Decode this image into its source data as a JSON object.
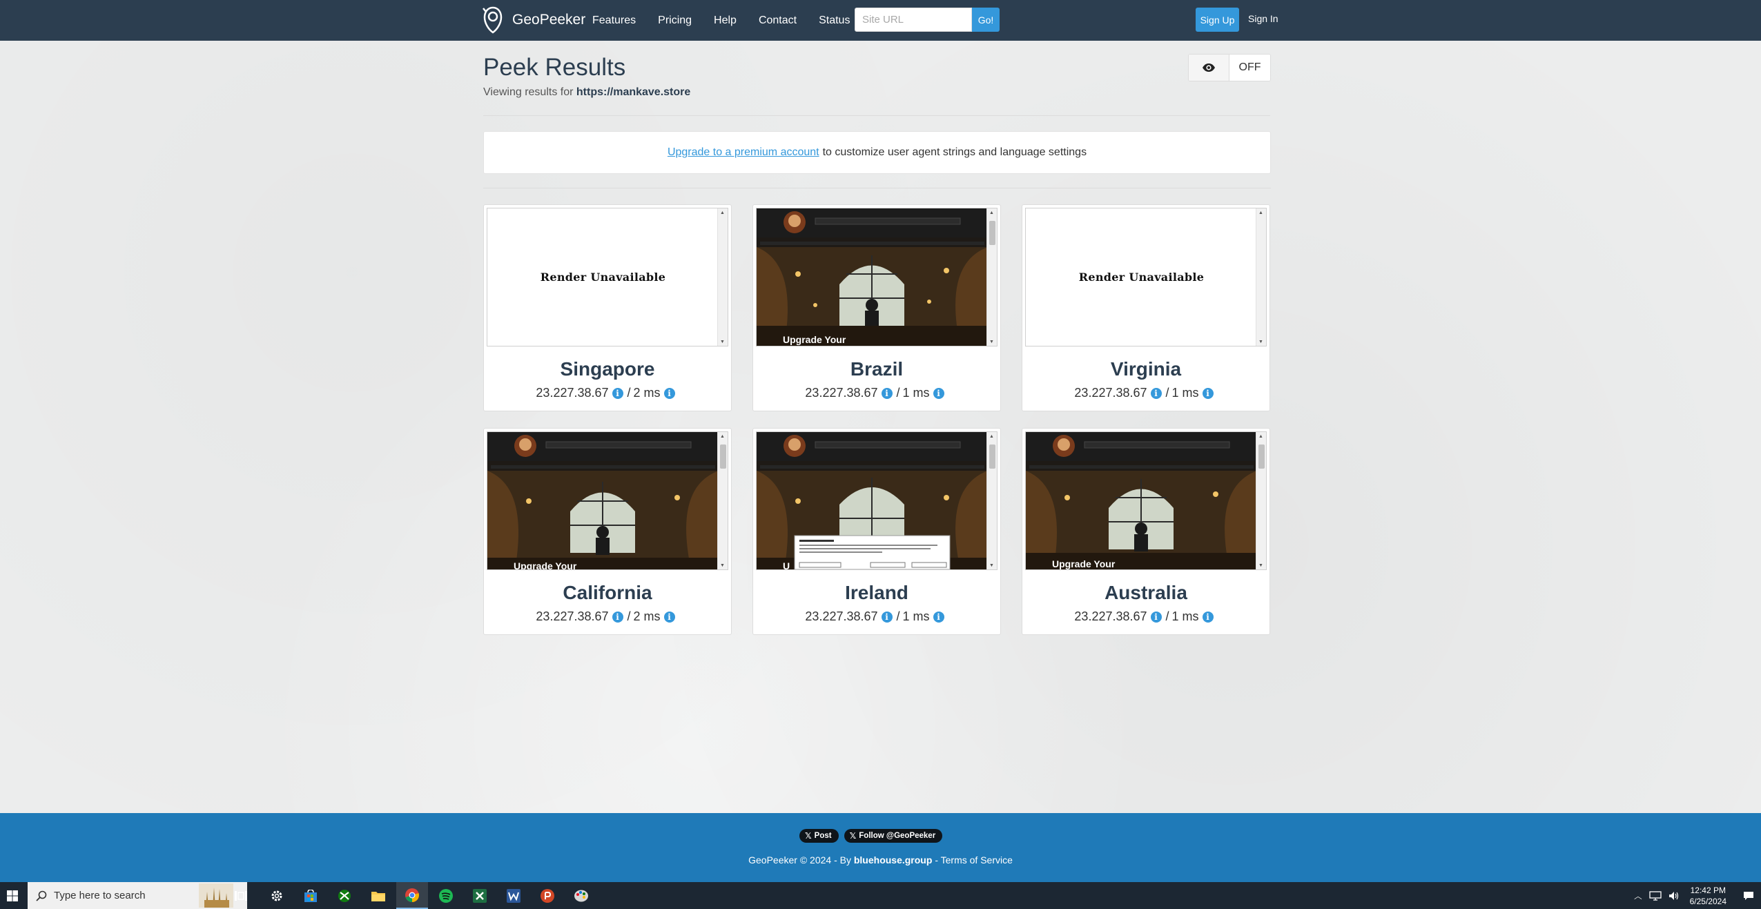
{
  "navbar": {
    "brand": "GeoPeeker",
    "links": [
      "Features",
      "Pricing",
      "Help",
      "Contact",
      "Status"
    ],
    "url_placeholder": "Site URL",
    "go_label": "Go!",
    "signup_label": "Sign Up",
    "signin_label": "Sign In"
  },
  "header": {
    "title": "Peek Results",
    "subtitle_prefix": "Viewing results for",
    "url": "https://mankave.store",
    "toggle_state": "OFF"
  },
  "upgrade": {
    "link_text": "Upgrade to a premium account",
    "rest_text": "to customize user agent strings and language settings"
  },
  "results": [
    {
      "location": "Singapore",
      "ip": "23.227.38.67",
      "latency": "2 ms",
      "render": "unavailable",
      "unavailable_text": "Render Unavailable"
    },
    {
      "location": "Brazil",
      "ip": "23.227.38.67",
      "latency": "1 ms",
      "render": "screenshot",
      "banner": "Upgrade Your"
    },
    {
      "location": "Virginia",
      "ip": "23.227.38.67",
      "latency": "1 ms",
      "render": "unavailable",
      "unavailable_text": "Render Unavailable"
    },
    {
      "location": "California",
      "ip": "23.227.38.67",
      "latency": "2 ms",
      "render": "screenshot",
      "banner": "Upgrade Your"
    },
    {
      "location": "Ireland",
      "ip": "23.227.38.67",
      "latency": "1 ms",
      "render": "screenshot_cookie",
      "banner": "U"
    },
    {
      "location": "Australia",
      "ip": "23.227.38.67",
      "latency": "1 ms",
      "render": "screenshot",
      "banner": "Upgrade Your"
    }
  ],
  "footer": {
    "post_label": "Post",
    "follow_label": "Follow @GeoPeeker",
    "copyright": "GeoPeeker © 2024 - By",
    "company": "bluehouse.group",
    "dash": "-",
    "terms": "Terms of Service"
  },
  "taskbar": {
    "search_placeholder": "Type here to search",
    "time": "12:42 PM",
    "date": "6/25/2024"
  },
  "colors": {
    "navbar": "#2c3e50",
    "accent": "#3498db",
    "footer": "#1f7ab8",
    "taskbar": "#1c2733"
  }
}
